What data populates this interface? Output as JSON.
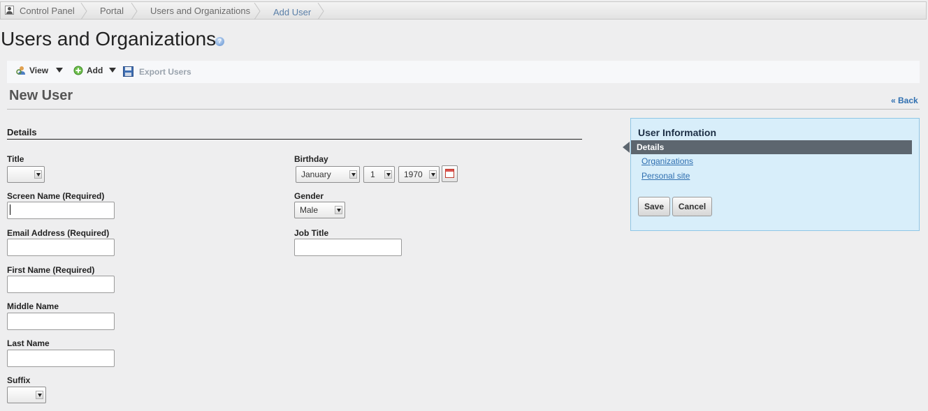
{
  "breadcrumb": {
    "items": [
      "Control Panel",
      "Portal",
      "Users and Organizations",
      "Add User"
    ]
  },
  "page": {
    "title": "Users and Organizations"
  },
  "toolbar": {
    "view_label": "View",
    "add_label": "Add",
    "export_label": "Export Users"
  },
  "section": {
    "title": "New User",
    "back_label": "« Back"
  },
  "details": {
    "heading": "Details",
    "fields": {
      "title_label": "Title",
      "title_value": "",
      "screen_name_label": "Screen Name (Required)",
      "screen_name_value": "",
      "email_label": "Email Address (Required)",
      "email_value": "",
      "first_name_label": "First Name (Required)",
      "first_name_value": "",
      "middle_name_label": "Middle Name",
      "middle_name_value": "",
      "last_name_label": "Last Name",
      "last_name_value": "",
      "suffix_label": "Suffix",
      "suffix_value": "",
      "birthday_label": "Birthday",
      "birthday_month": "January",
      "birthday_day": "1",
      "birthday_year": "1970",
      "gender_label": "Gender",
      "gender_value": "Male",
      "job_title_label": "Job Title",
      "job_title_value": ""
    }
  },
  "sidebar": {
    "title": "User Information",
    "active": "Details",
    "links": [
      "Organizations",
      "Personal site"
    ],
    "save_label": "Save",
    "cancel_label": "Cancel"
  },
  "colors": {
    "accent_link": "#2f6fb0",
    "panel_bg": "#d8eefa",
    "panel_border": "#8ec6e6",
    "active_item_bg": "#5d666f"
  },
  "icons": [
    "user-icon",
    "help-icon",
    "view-users-icon",
    "add-icon",
    "export-icon",
    "calendar-icon"
  ]
}
